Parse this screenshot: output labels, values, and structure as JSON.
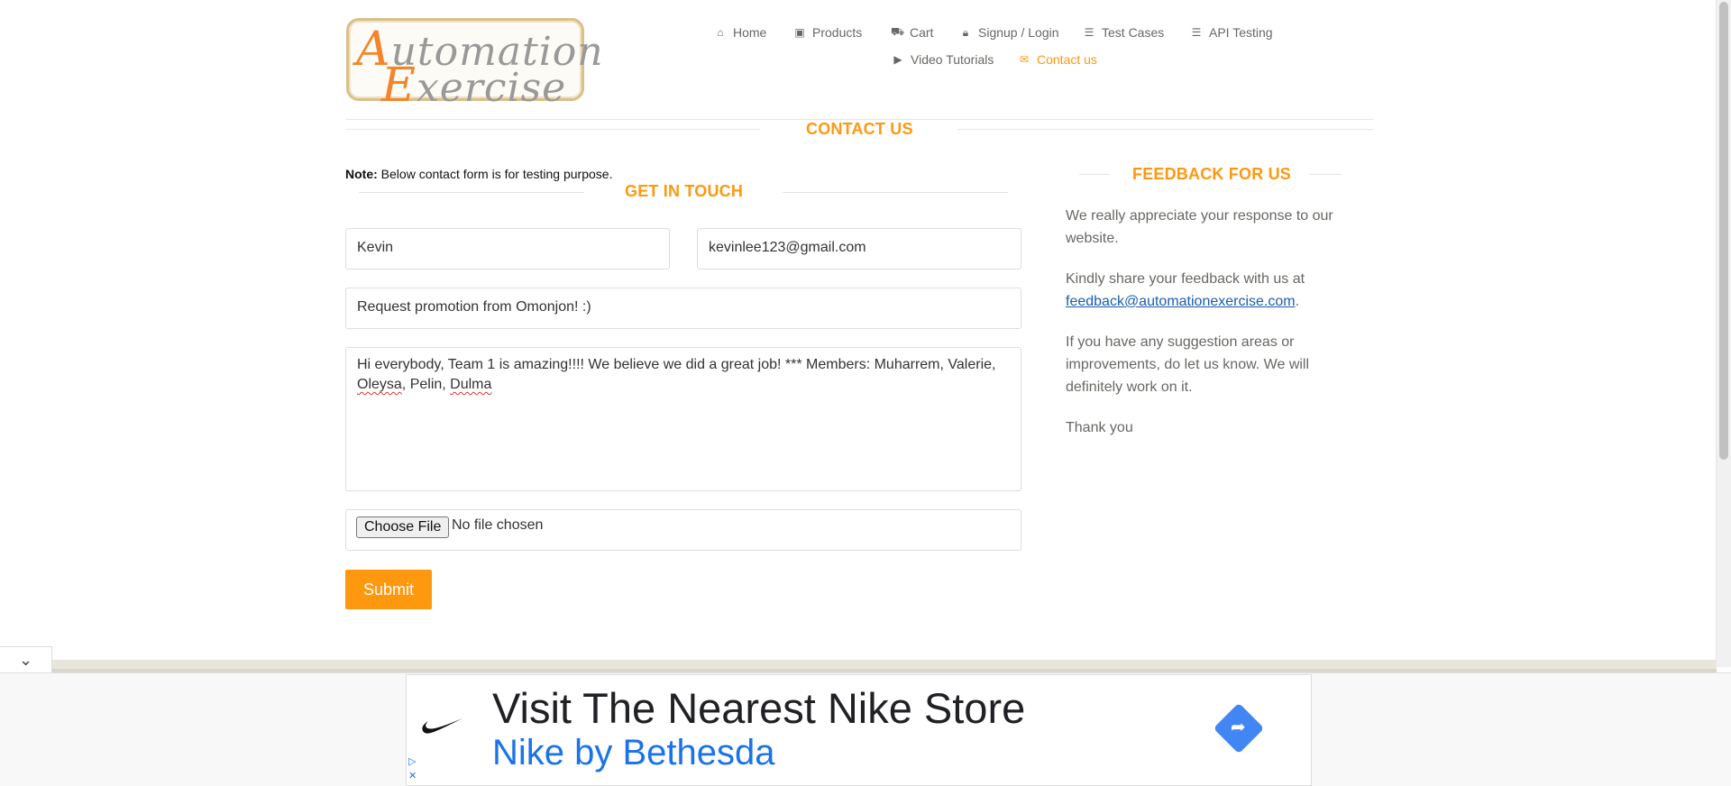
{
  "logo": {
    "line1_cap": "A",
    "line1_rest": "utomation",
    "line2_cap": "E",
    "line2_rest": "xercise"
  },
  "nav": {
    "home": "Home",
    "products": "Products",
    "cart": "Cart",
    "signup": "Signup / Login",
    "test_cases": "Test Cases",
    "api_testing": "API Testing",
    "video_tutorials": "Video Tutorials",
    "contact_us": "Contact us"
  },
  "contact": {
    "heading": "CONTACT US",
    "note_label": "Note:",
    "note_text": " Below contact form is for testing purpose.",
    "get_in_touch": "GET IN TOUCH",
    "name_value": "Kevin",
    "email_value": "kevinlee123@gmail.com",
    "subject_value": "Request promotion from Omonjon! :)",
    "message_line1": "Hi everybody, Team 1 is amazing!!!! We believe we did a great job! *** Members: Muharrem, Valerie,",
    "message_w1": "Oleysa",
    "message_mid": ", Pelin, ",
    "message_w2": "Dulma",
    "file_button": "Choose File",
    "file_status": "No file chosen",
    "submit": "Submit"
  },
  "feedback": {
    "heading": "FEEDBACK FOR US",
    "p1": "We really appreciate your response to our website.",
    "p2_text": "Kindly share your feedback with us at",
    "p2_link": "feedback@automationexercise.com",
    "p2_end": ".",
    "p3": "If you have any suggestion areas or improvements, do let us know. We will definitely work on it.",
    "p4": "Thank you"
  },
  "ad": {
    "title": "Visit The Nearest Nike Store",
    "subtitle": "Nike by Bethesda"
  },
  "colors": {
    "accent": "#fe980f",
    "link": "#1a5dad",
    "ad_blue": "#1a73e8"
  }
}
